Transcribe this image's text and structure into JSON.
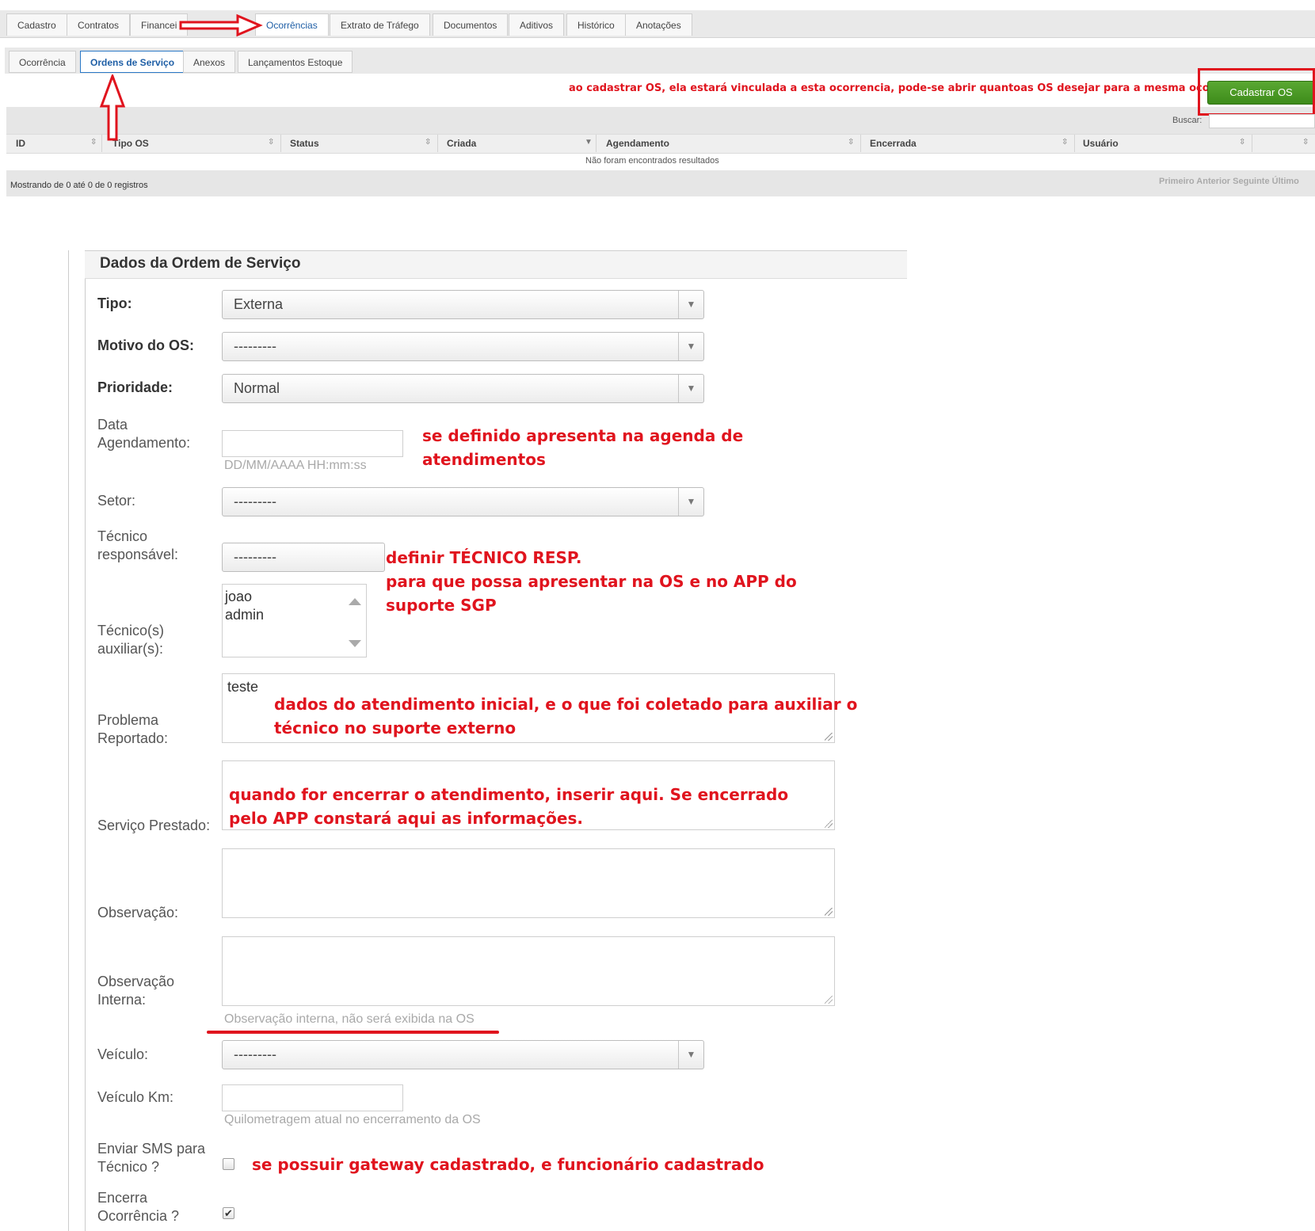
{
  "top_tabs": [
    {
      "label": "Cadastro"
    },
    {
      "label": "Contratos"
    },
    {
      "label": "Financei"
    },
    {
      "label": "Ocorrências"
    },
    {
      "label": "Extrato de Tráfego"
    },
    {
      "label": "Documentos"
    },
    {
      "label": "Aditivos"
    },
    {
      "label": "Histórico"
    },
    {
      "label": "Anotações"
    }
  ],
  "sub_tabs": [
    {
      "label": "Ocorrência"
    },
    {
      "label": "Ordens de Serviço"
    },
    {
      "label": "Anexos"
    },
    {
      "label": "Lançamentos Estoque"
    }
  ],
  "toolbar": {
    "note": "ao cadastrar OS, ela estará vinculada a esta ocorrencia, pode-se abrir quantoas OS desejar para a mesma ocorrencia.",
    "cadastrar_label": "Cadastrar OS",
    "search_label": "Buscar:"
  },
  "table": {
    "columns": [
      "ID",
      "Tipo OS",
      "Status",
      "Criada",
      "Agendamento",
      "Encerrada",
      "Usuário"
    ],
    "empty_text": "Não foram encontrados resultados",
    "info": "Mostrando de 0 até 0 de 0 registros",
    "pagination": [
      "Primeiro",
      "Anterior",
      "Seguinte",
      "Último"
    ]
  },
  "form": {
    "title": "Dados da Ordem de Serviço",
    "tipo": {
      "label": "Tipo:",
      "value": "Externa"
    },
    "motivo": {
      "label": "Motivo do OS:",
      "value": "---------"
    },
    "prioridade": {
      "label": "Prioridade:",
      "value": "Normal"
    },
    "data_agendamento": {
      "label_1": "Data",
      "label_2": "Agendamento:",
      "hint": "DD/MM/AAAA HH:mm:ss"
    },
    "setor": {
      "label": "Setor:",
      "value": "---------"
    },
    "tecnico": {
      "label_1": "Técnico",
      "label_2": "responsável:",
      "value": "---------"
    },
    "auxiliares": {
      "label_1": "Técnico(s)",
      "label_2": "auxiliar(s):",
      "options": [
        "joao",
        "admin"
      ]
    },
    "problema": {
      "label_1": "Problema",
      "label_2": "Reportado:",
      "value": "teste"
    },
    "servico": {
      "label": "Serviço Prestado:"
    },
    "observacao": {
      "label": "Observação:"
    },
    "obs_interna": {
      "label_1": "Observação",
      "label_2": "Interna:",
      "hint": "Observação interna, não será exibida na OS"
    },
    "veiculo": {
      "label": "Veículo:",
      "value": "---------"
    },
    "veiculo_km": {
      "label": "Veículo Km:",
      "hint": "Quilometragem atual no encerramento da OS"
    },
    "enviar_sms": {
      "label_1": "Enviar SMS para",
      "label_2": "Técnico ?",
      "checked": false
    },
    "encerra": {
      "label_1": "Encerra",
      "label_2": "Ocorrência ?",
      "checked": true
    }
  },
  "annotations": {
    "agenda_1": "se definido apresenta na agenda de",
    "agenda_2": "atendimentos",
    "tecnico_1": "definir TÉCNICO RESP.",
    "tecnico_2": "para que possa apresentar na OS e no APP do",
    "tecnico_3": "suporte SGP",
    "problema_1": "dados do atendimento inicial, e o que foi coletado para auxiliar o",
    "problema_2": "técnico no suporte externo",
    "servico_1": "quando for encerrar o atendimento, inserir aqui. Se encerrado",
    "servico_2": "pelo APP constará aqui as informações.",
    "sms": "se possuir gateway cadastrado, e funcionário cadastrado"
  },
  "colors": {
    "accent_red": "#e0141e",
    "button_green": "#4a9a25",
    "link_blue": "#1f5fa6"
  }
}
